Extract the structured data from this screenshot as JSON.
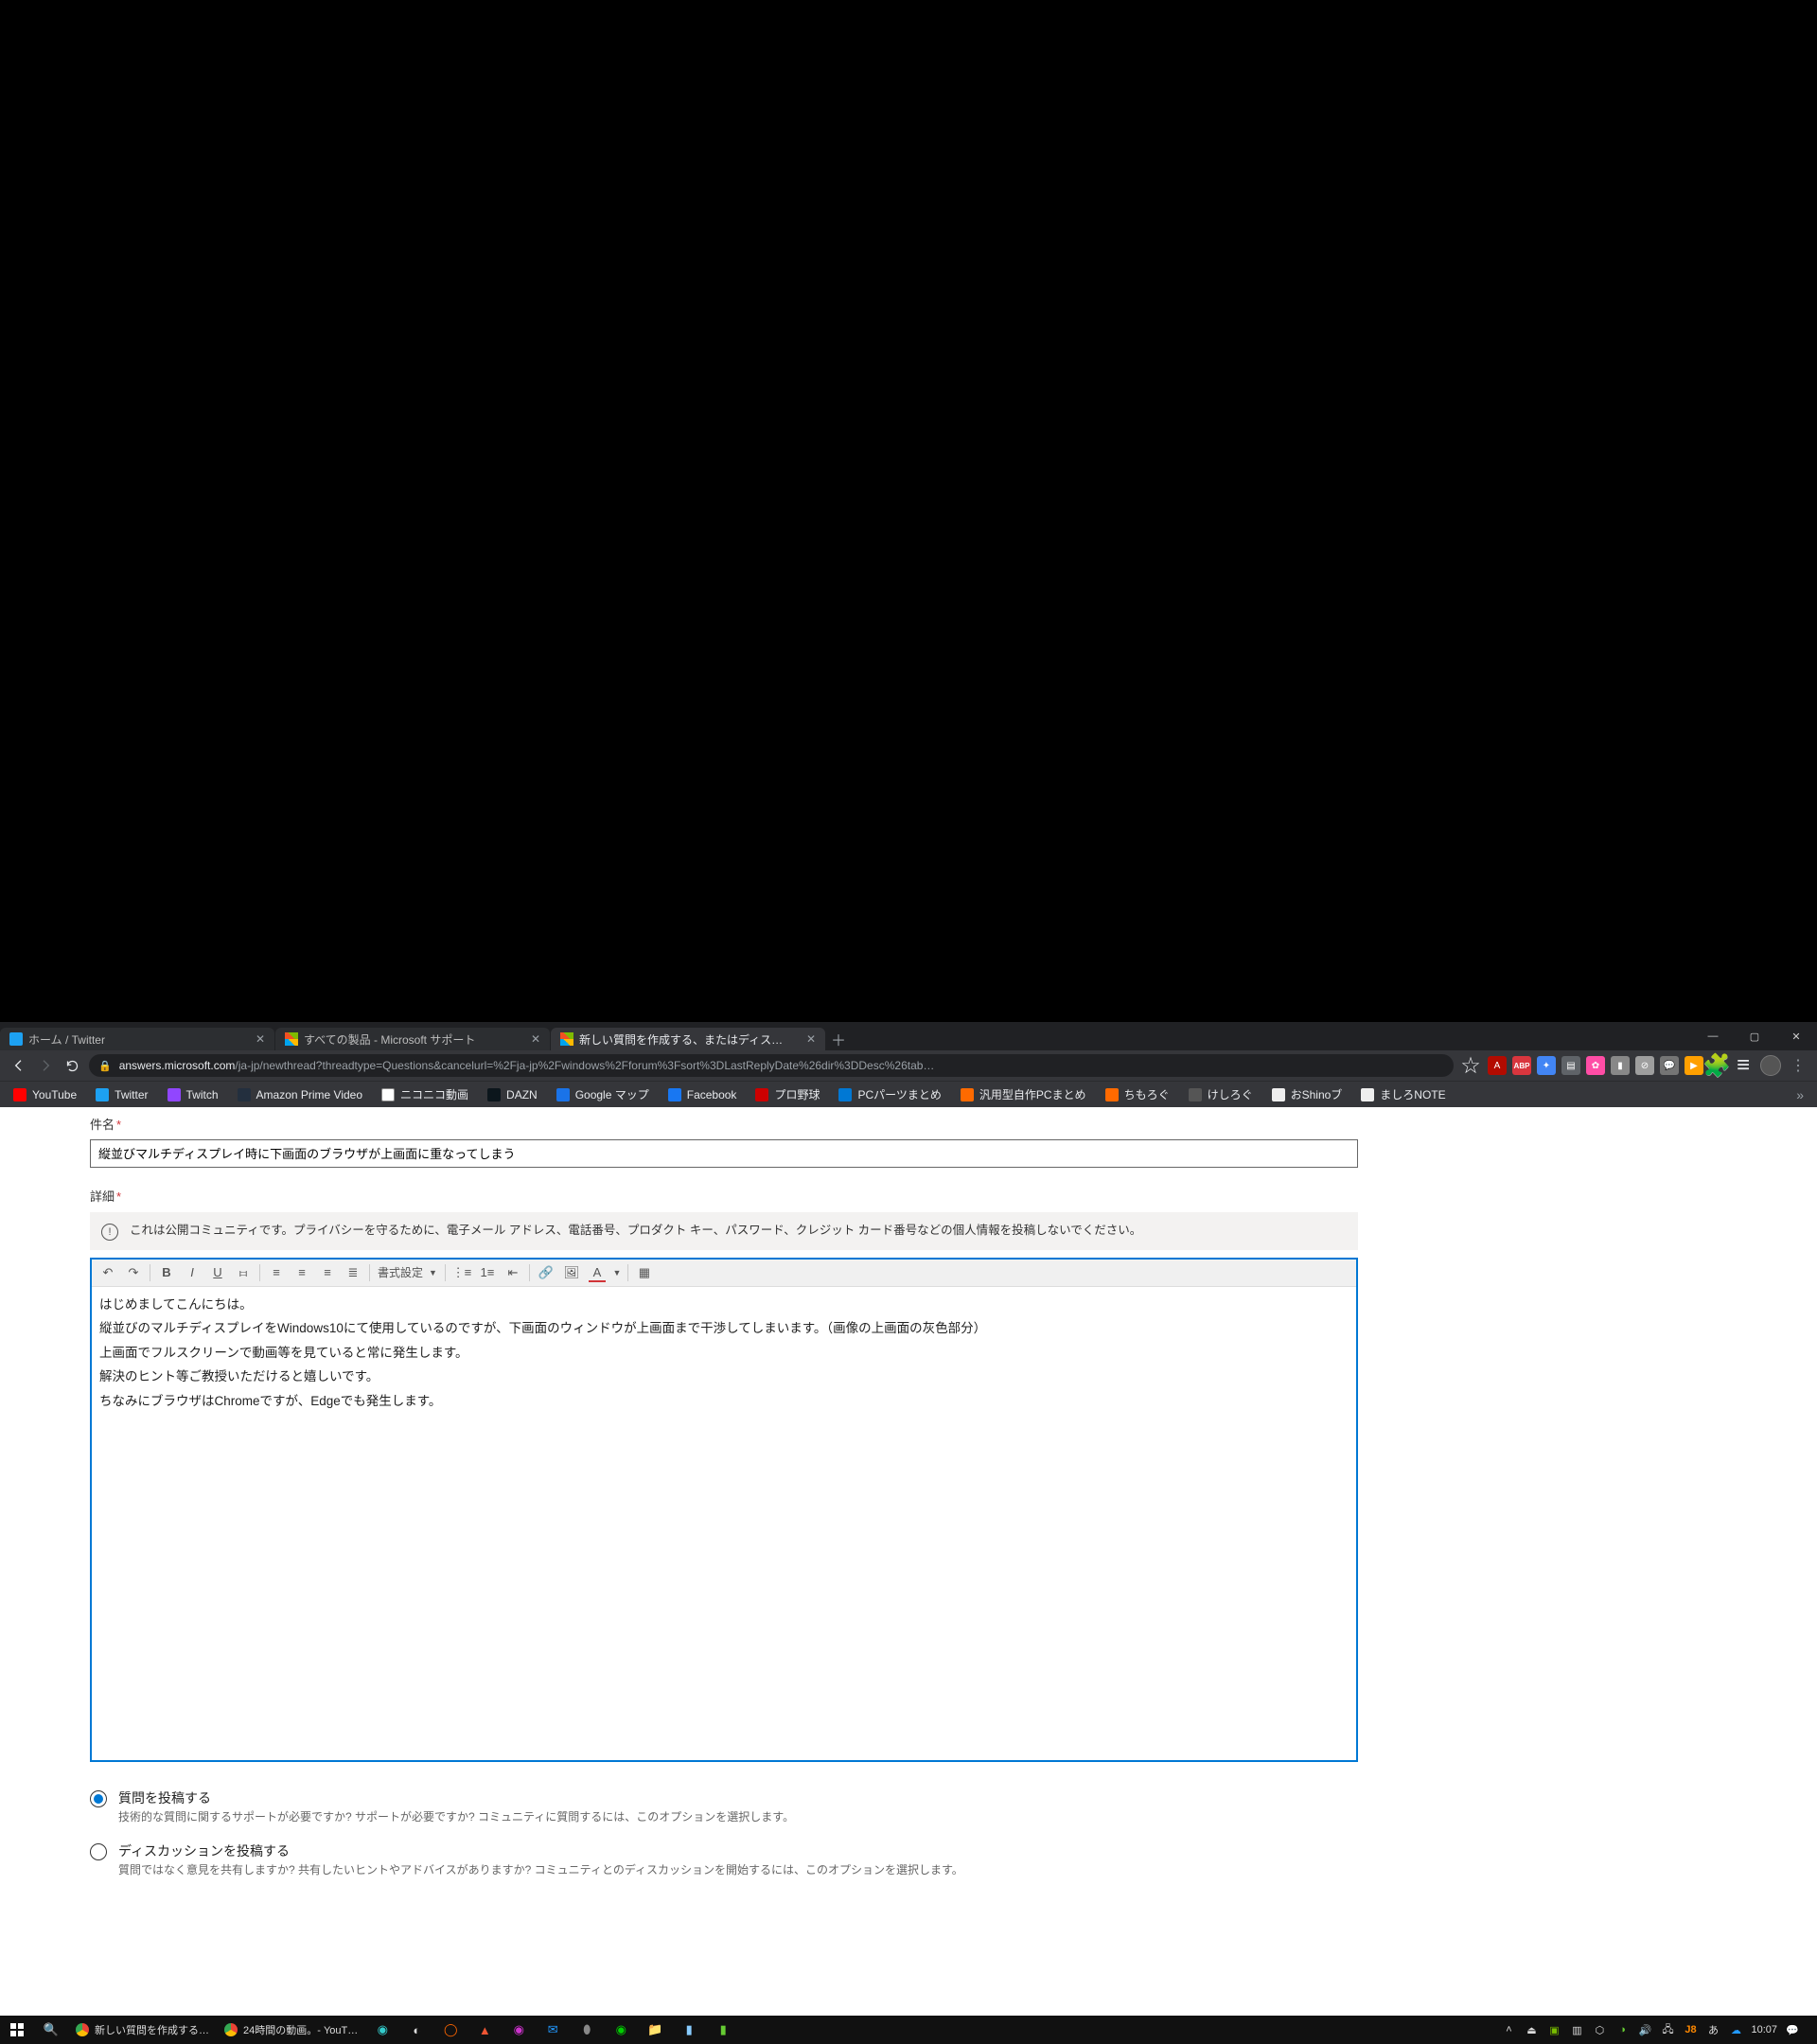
{
  "browser": {
    "tabs": [
      {
        "title": "ホーム / Twitter",
        "favicon": "twitter"
      },
      {
        "title": "すべての製品 - Microsoft サポート",
        "favicon": "microsoft"
      },
      {
        "title": "新しい質問を作成する、またはディス…",
        "favicon": "microsoft",
        "active": true
      }
    ],
    "url_host": "answers.microsoft.com",
    "url_path": "/ja-jp/newthread?threadtype=Questions&cancelurl=%2Fja-jp%2Fwindows%2Fforum%3Fsort%3DLastReplyDate%26dir%3DDesc%26tab…"
  },
  "bookmarks": [
    {
      "label": "YouTube",
      "fav": "fav-yt"
    },
    {
      "label": "Twitter",
      "fav": "fav-tw"
    },
    {
      "label": "Twitch",
      "fav": "fav-twi"
    },
    {
      "label": "Amazon Prime Video",
      "fav": "fav-amz"
    },
    {
      "label": "ニコニコ動画",
      "fav": "fav-nico"
    },
    {
      "label": "DAZN",
      "fav": "fav-dazn"
    },
    {
      "label": "Google マップ",
      "fav": "fav-gm"
    },
    {
      "label": "Facebook",
      "fav": "fav-fb"
    },
    {
      "label": "プロ野球",
      "fav": "fav-red"
    },
    {
      "label": "PCパーツまとめ",
      "fav": "fav-blue"
    },
    {
      "label": "汎用型自作PCまとめ",
      "fav": "fav-orange"
    },
    {
      "label": "ちもろぐ",
      "fav": "fav-orange"
    },
    {
      "label": "けしろぐ",
      "fav": "fav-gray"
    },
    {
      "label": "おShinoブ",
      "fav": "fav-white"
    },
    {
      "label": "ましろNOTE",
      "fav": "fav-white"
    }
  ],
  "form": {
    "subject_label": "件名",
    "subject_value": "縦並びマルチディスプレイ時に下画面のブラウザが上画面に重なってしまう",
    "detail_label": "詳細",
    "notice": "これは公開コミュニティです。プライバシーを守るために、電子メール アドレス、電話番号、プロダクト キー、パスワード、クレジット カード番号などの個人情報を投稿しないでください。",
    "format_label": "書式設定",
    "body_lines": [
      "はじめましてこんにちは。",
      "縦並びのマルチディスプレイをWindows10にて使用しているのですが、下画面のウィンドウが上画面まで干渉してしまいます。（画像の上画面の灰色部分）",
      "上画面でフルスクリーンで動画等を見ていると常に発生します。",
      "解決のヒント等ご教授いただけると嬉しいです。",
      "ちなみにブラウザはChromeですが、Edgeでも発生します。"
    ],
    "radio1_title": "質問を投稿する",
    "radio1_desc": "技術的な質問に関するサポートが必要ですか? サポートが必要ですか? コミュニティに質問するには、このオプションを選択します。",
    "radio2_title": "ディスカッションを投稿する",
    "radio2_desc": "質問ではなく意見を共有しますか? 共有したいヒントやアドバイスがありますか? コミュニティとのディスカッションを開始するには、このオプションを選択します。"
  },
  "taskbar": {
    "apps": [
      {
        "label": "新しい質問を作成する…",
        "fav": "fav-gm"
      },
      {
        "label": "24時間の動画。- YouT…",
        "fav": "fav-gm"
      }
    ],
    "ime": "あ",
    "time": "10:07"
  }
}
